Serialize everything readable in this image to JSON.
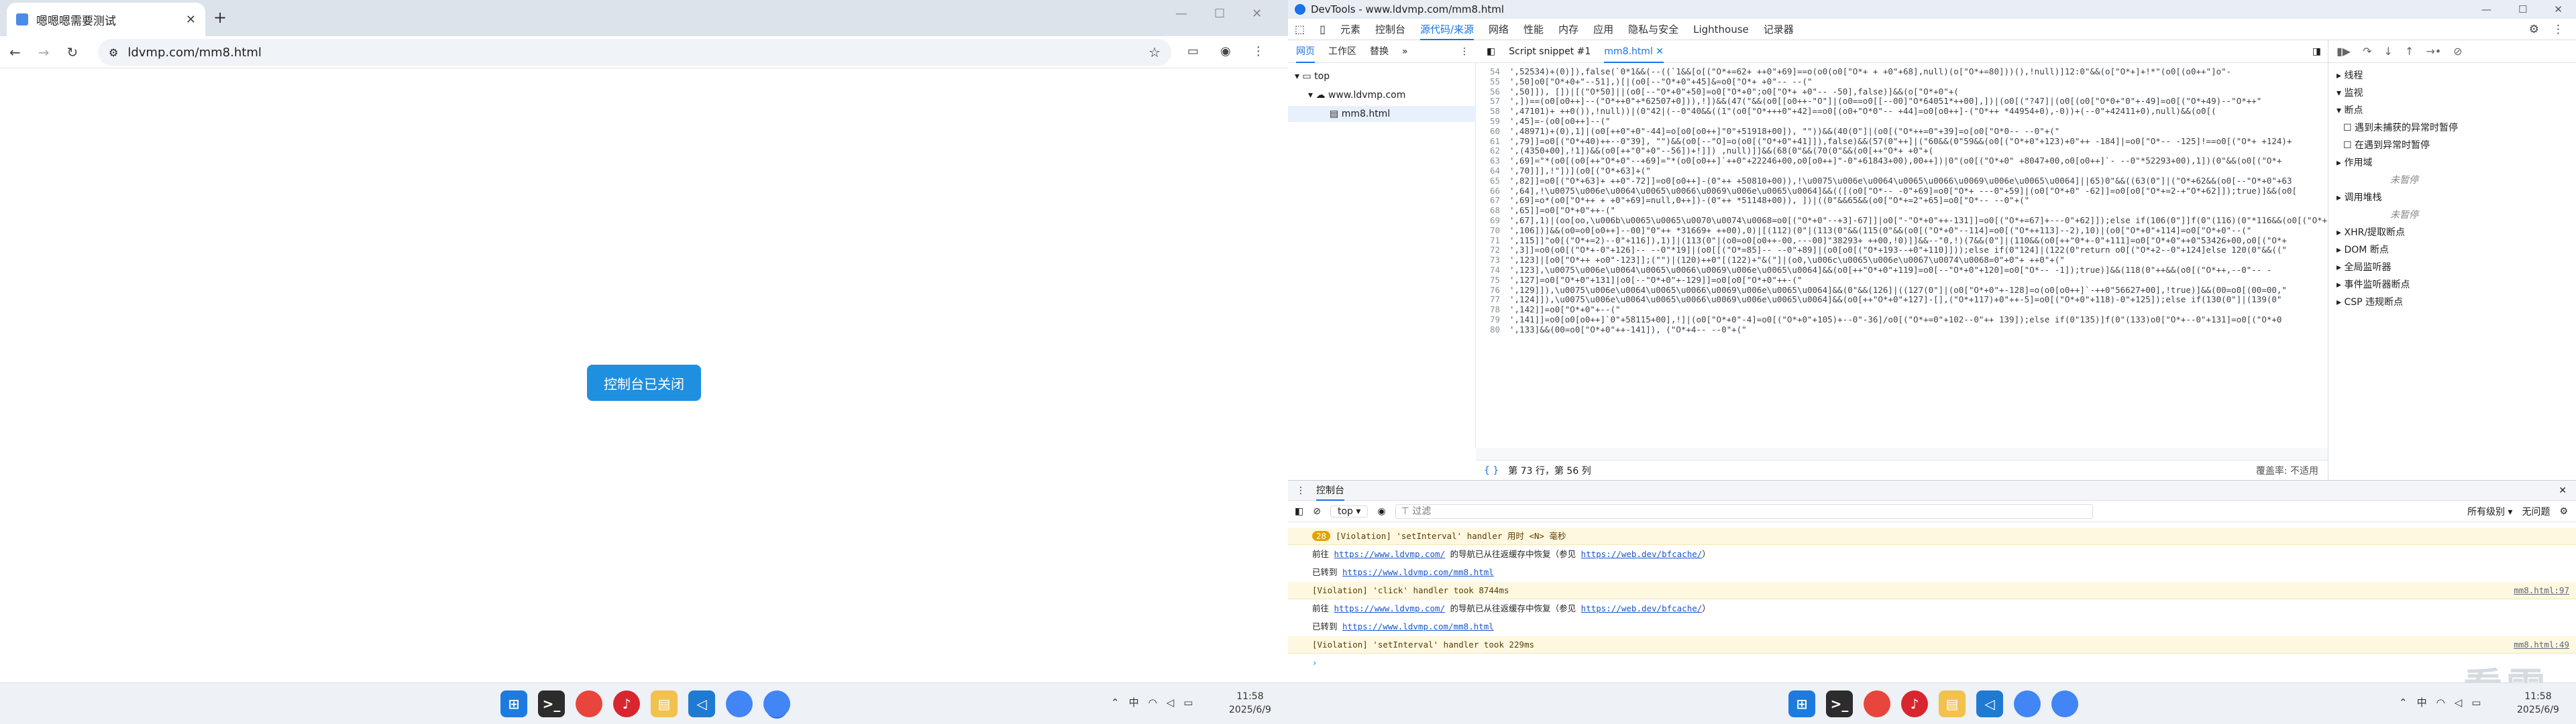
{
  "left_browser": {
    "tab_title": "嗯嗯嗯需要测试",
    "url": "ldvmp.com/mm8.html",
    "page_button": "控制台已关闭"
  },
  "taskbar_left": {
    "tray_chars": "中",
    "time": "11:58",
    "date": "2025/6/9"
  },
  "devtools": {
    "window_title": "DevTools - www.ldvmp.com/mm8.html",
    "tabs": [
      "元素",
      "控制台",
      "源代码/来源",
      "网络",
      "性能",
      "内存",
      "应用",
      "隐私与安全",
      "Lighthouse",
      "记录器"
    ],
    "source_subtabs": [
      "网页",
      "工作区",
      "替换"
    ],
    "file_tree": [
      "top",
      "www.ldvmp.com",
      "mm8.html"
    ],
    "editor_tabs": [
      "Script snippet #1",
      "mm8.html"
    ],
    "code_lines": [
      {
        "n": "54",
        "t": "',52534)+(0)]),false(`0*1&&(--((`1&&[o[(\"O*+=62+ ++0\"+69]==o(o0(o0[\"O*+ + +0\"+68],null)(o[\"O*+=80]))(),!null)]12:0\"&&(o[\"O*+]+!*\"(o0[(o0++\"]o\"-"
      },
      {
        "n": "55",
        "t": "',50]o0[\"O*+0+\"--51],)[|(o0[--\"O*+0\"+45]&=o0[\"O*+ +0\"-- --(\""
      },
      {
        "n": "56",
        "t": "',50]]), [])|[(\"O*50]||(o0[--\"O*+0\"+50]=o0[\"O*+0\";o0[\"O*+ +0\"-- -50],false)]&&(o[\"O*+0\"+("
      },
      {
        "n": "57",
        "t": "',])==(o0[o0++]--(\"O*++0\"+*62507+0])),!])&&(47(\"&&(o0[[o0++-\"O\"]|(o0==o0[[--00]\"O*64051*++00],])|(o0[(\"?47]|(o0[(o0[\"O*0+\"0\"+-49]=o0[(\"O*+49)--\"O*++\""
      },
      {
        "n": "58",
        "t": "',47101)+ ++0()),!null))|(0\"42|(--0\"40&&((1\"(o0[\"O*+++0\"+42]==o0[(o0+\"O*0\"-- +44]=o0[o0++]-(\"O*++ *44954+0),-0))+(--0\"+42411+0),null)&&(o0[("
      },
      {
        "n": "59",
        "t": "',45]=-(o0[o0++]--(\""
      },
      {
        "n": "60",
        "t": "',48971)+(0),1]|(o0[++0\"+0\"-44]=o[o0[o0++]\"0\"+51918+00]), \"\"))&&(40(0\"]|(o0[(\"O*++=0\"+39]=o[o0[\"O*0-- --0\"+(\""
      },
      {
        "n": "61",
        "t": "',79]]=o0[(\"O*+40)++--0\"39], \"\")&&(o0[--\"O]=o(o0[(\"O*+0\"+41]]),false)&&(57(0\"++]|(\"60&&(0\"59&&(o0[(\"O*+0\"+123)+0\"++ -184]|=o0[\"O*-- -125]!==o0[(\"O*+ +124)+"
      },
      {
        "n": "62",
        "t": "',(4350+00],!1])&&(o0[++\"0\"+0\"--56])+!]]) ,null)]]&&(68(0\"&&(70(0\"&&(o0[++\"O*+ +0\"+("
      },
      {
        "n": "63",
        "t": "',69]=\"*(o0[(o0[++\"O*+0\"--+69]=\"*(o0[o0++]`++0\"+22246+00,o0[o0++]\"-0\"+61843+00),00++])|0\"(o0[(\"O*+0\" +8047+00,o0[o0++]`- --0\"*52293+00),1])(0\"&&(o0[(\"O*+"
      },
      {
        "n": "64",
        "t": "',70]]],!\"])](o0[(\"O*+63]+(\""
      },
      {
        "n": "65",
        "t": "',82]]=o0[(\"O*+63]+ ++0\"-72]]=o0[o0++]-(0\"++ +50810+00)),!\\u0075\\u006e\\u0064\\u0065\\u0066\\u0069\\u006e\\u0065\\u0064]||65)0\"&&((63(0\"]|(\"O*+62&&(o0[--\"O*+0\"+63"
      },
      {
        "n": "66",
        "t": "',64],!\\u0075\\u006e\\u0064\\u0065\\u0066\\u0069\\u006e\\u0065\\u0064]&&(([(o0[\"O*-- -0\"+69]=o0[\"O*+ ---0\"+59]|(o0[\"O*+0\" -62]]=o0[o0[\"O*+=2-+\"O*+62]]);true)]&&(o0["
      },
      {
        "n": "67",
        "t": "',69]=o*(o0[\"O*++ + +0\"+69]=null,0++])-(0\"++ *51148+00)), ])|((0\"&&65&&(o0[\"O*+=2\"+65]=o0[\"O*-- --0\"+(\""
      },
      {
        "n": "68",
        "t": "',65]]=o0[\"O*+0\"++-(\""
      },
      {
        "n": "69",
        "t": "',67],1)|(oo[oo,\\u006b\\u0065\\u0065\\u0070\\u0074\\u0068=o0[(\"O*+0\"--+3]-67]]|o0[\"-\"O*+0\"++-131]]=o0[(\"O*+=67]+---0\"+62]]);else if(106(0\"]]f(0\"(116)(0\"*116&&(o0[(\"O*+"
      },
      {
        "n": "70",
        "t": "',106])]&&(o0=o0[o0++]--00]\"0\"++ *31669+ ++00),0)|[(112)(0\"|(113(0\"&&(115(0\"&&(o0[(\"O*+0\"--114]=o0[(\"O*++113]--2),10)|(o0[\"O*+0\"+114]=o0[\"O*+0\"--(\""
      },
      {
        "n": "71",
        "t": "',115]]\"o0[(\"O*+=2)--0\"+116]),1)]|(113(0\"|(o0=o0[o0++-00,---00]\"38293+ ++00,!0)]]&&--\"0,!)(7&&(0\"]|(110&&(o0[++\"0*+-0\"+111]=o0[\"O*+0\"++0\"53426+00,o0[(\"O*+"
      },
      {
        "n": "72",
        "t": "',3]]=o0(o0[(\"O*+-0\"+126]-- --0\"*19]|(o0[[(\"O*=85]-- --0\"+89]|(o0[o0[(\"O*+193--+0\"+110]]));else if(0\"124]|(122(0\"return o0[(\"O*+2--0\"+124]else 120(0\"&&((\""
      },
      {
        "n": "73",
        "t": "',123]|[o0[\"O*++ +o0\"-123]];(\"\")|(120)++0\"[(122)+\"&(\"]|(o0,\\u006c\\u0065\\u006e\\u0067\\u0074\\u0068=0\"+0\"+ ++0\"+(\""
      },
      {
        "n": "74",
        "t": "',123],\\u0075\\u006e\\u0064\\u0065\\u0066\\u0069\\u006e\\u0065\\u0064]&&(o0[++\"O*+0\"+119]=o0[--\"O*+0\"+120]=o0[\"O*-- -1]);true)]&&(118(0\"++&&(o0[(\"O*++,--0\"-- -"
      },
      {
        "n": "75",
        "t": "',127]=o0[\"O*+0\"+131]|o0[--\"O*+0\"+-129]]=o0[o0[\"O*+0\"++-(\""
      },
      {
        "n": "76",
        "t": "',129]]),\\u0075\\u006e\\u0064\\u0065\\u0066\\u0069\\u006e\\u0065\\u0064]&&(0\"&&(126]|((127(0\"]|(o0[\"O*+0\"+-128]=o(o0[o0++]`-++0\"56627+00],!true)]&&(00=o0[(00=00,\""
      },
      {
        "n": "77",
        "t": "',124]]),\\u0075\\u006e\\u0064\\u0065\\u0066\\u0069\\u006e\\u0065\\u0064]&&(o0[++\"O*+0\"+127]-[],(\"O*+117)+0\"++-5]=o0[(\"O*+0\"+118)-0\"+125]);else if(130(0\"]|(139(0\""
      },
      {
        "n": "78",
        "t": "',142]]=o0[\"O*+0\"+--(\""
      },
      {
        "n": "79",
        "t": "',141]]=o0[o0[o0++]`0\"+58115+00],!]|(o0[\"O*+0\"-4]=o0[(\"O*+0\"+105)+--0\"-36]/o0[(\"O*+=0\"+102--0\"++ 139]);else if(0\"135)]f(0\"(133)o0[\"O*+--0\"+131]=o0[(\"O*+0"
      },
      {
        "n": "80",
        "t": "',133]&&(00=o0[\"O*+0\"++-141]), (\"O*+4-- --0\"+(\""
      }
    ],
    "status_position": "第 73 行，第 56 列",
    "status_coverage": "覆盖率: 不适用",
    "debugger_sections": [
      "线程",
      "监视",
      "断点",
      "遇到未捕获的异常时暂停",
      "在遇到异常时暂停",
      "作用域",
      "未暂停",
      "调用堆栈",
      "未暂停",
      "XHR/提取断点",
      "DOM 断点",
      "全局监听器",
      "事件监听器断点",
      "CSP 违规断点"
    ],
    "console": {
      "title": "控制台",
      "context": "top",
      "filter_placeholder": "过滤",
      "levels": "所有级别",
      "issues": "无问题",
      "badge": "28",
      "messages": [
        {
          "kind": "warn",
          "text": "[Violation] 'setInterval' handler 用时 <N> 毫秒",
          "src": ""
        },
        {
          "kind": "plain",
          "prefix": "前往 ",
          "link": "https://www.ldvmp.com/",
          "mid": " 的导航已从往返缓存中恢复（参见 ",
          "link2": "https://web.dev/bfcache/",
          "end": "）"
        },
        {
          "kind": "plain",
          "prefix": "已转到 ",
          "link": "https://www.ldvmp.com/mm8.html",
          "mid": "",
          "link2": "",
          "end": ""
        },
        {
          "kind": "warn",
          "text": "[Violation] 'click' handler took 8744ms",
          "src": "mm8.html:97"
        },
        {
          "kind": "plain",
          "prefix": "前往 ",
          "link": "https://www.ldvmp.com/",
          "mid": " 的导航已从往返缓存中恢复（参见 ",
          "link2": "https://web.dev/bfcache/",
          "end": "）"
        },
        {
          "kind": "plain",
          "prefix": "已转到 ",
          "link": "https://www.ldvmp.com/mm8.html",
          "mid": "",
          "link2": "",
          "end": ""
        },
        {
          "kind": "warn",
          "text": "[Violation] 'setInterval' handler took 229ms",
          "src": "mm8.html:49"
        }
      ]
    }
  },
  "taskbar_right": {
    "tray_chars": "中",
    "time": "11:58",
    "date": "2025/6/9"
  },
  "watermark": "看雪"
}
